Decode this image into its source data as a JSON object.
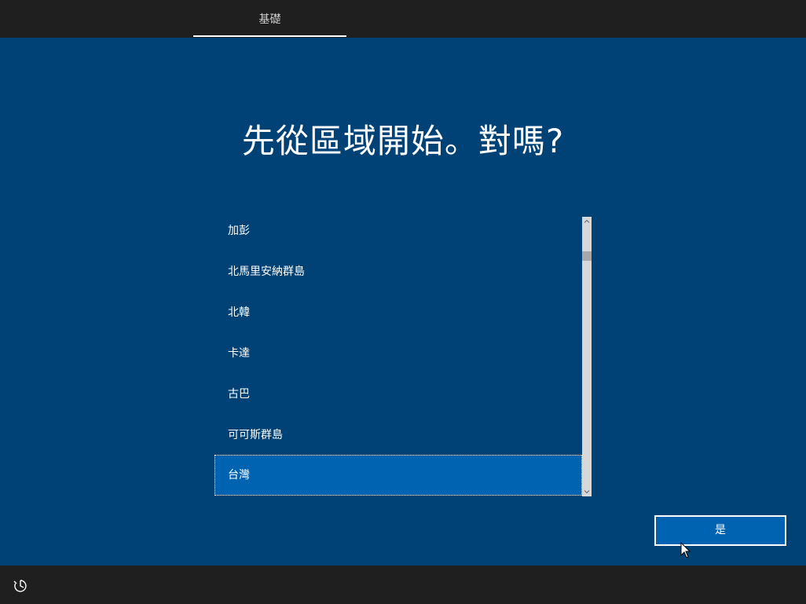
{
  "header": {
    "tab_label": "基礎"
  },
  "main": {
    "heading": "先從區域開始。對嗎?"
  },
  "region_list": {
    "items": [
      {
        "label": "加彭",
        "selected": false
      },
      {
        "label": "北馬里安納群島",
        "selected": false
      },
      {
        "label": "北韓",
        "selected": false
      },
      {
        "label": "卡達",
        "selected": false
      },
      {
        "label": "古巴",
        "selected": false
      },
      {
        "label": "可可斯群島",
        "selected": false
      },
      {
        "label": "台灣",
        "selected": true
      }
    ]
  },
  "actions": {
    "yes_label": "是"
  },
  "icons": {
    "accessibility": "ease-of-access-icon",
    "scroll_up": "chevron-up-icon",
    "scroll_down": "chevron-down-icon"
  },
  "colors": {
    "background": "#004275",
    "bar": "#1f1f1f",
    "selected": "#0063b1",
    "text": "#ffffff"
  }
}
